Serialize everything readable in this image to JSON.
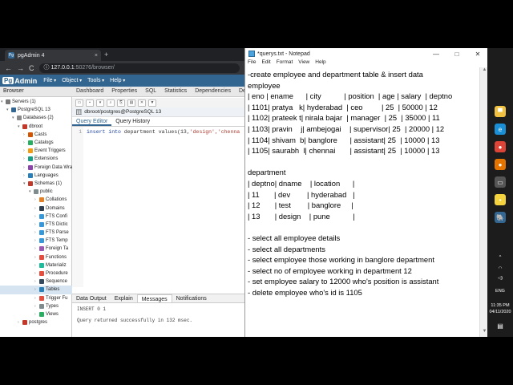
{
  "browser": {
    "tab_title": "pgAdmin 4",
    "tab_close": "×",
    "newtab": "+",
    "nav": {
      "back": "←",
      "forward": "→",
      "reload": "C",
      "info": "ⓘ"
    },
    "url_host": "127.0.0.1",
    "url_path": ":50276/browser/"
  },
  "pgadmin": {
    "logo_pg": "Pg",
    "logo_text": "Admin",
    "menu": [
      "File",
      "Object",
      "Tools",
      "Help"
    ],
    "left_tab": "Browser",
    "tree": [
      {
        "label": "Servers (1)",
        "indent": 0,
        "arrow": "▾",
        "color": "#777"
      },
      {
        "label": "PostgreSQL 13",
        "indent": 1,
        "arrow": "▾",
        "color": "#336791"
      },
      {
        "label": "Databases (2)",
        "indent": 2,
        "arrow": "▾",
        "color": "#8b8b8b"
      },
      {
        "label": "dbroot",
        "indent": 3,
        "arrow": "▾",
        "color": "#c0392b"
      },
      {
        "label": "Casts",
        "indent": 4,
        "arrow": "›",
        "color": "#d35400"
      },
      {
        "label": "Catalogs",
        "indent": 4,
        "arrow": "›",
        "color": "#27ae60"
      },
      {
        "label": "Event Triggers",
        "indent": 4,
        "arrow": "›",
        "color": "#f39c12"
      },
      {
        "label": "Extensions",
        "indent": 4,
        "arrow": "›",
        "color": "#16a085"
      },
      {
        "label": "Foreign Data Wra",
        "indent": 4,
        "arrow": "›",
        "color": "#8e44ad"
      },
      {
        "label": "Languages",
        "indent": 4,
        "arrow": "›",
        "color": "#2980b9"
      },
      {
        "label": "Schemas (1)",
        "indent": 4,
        "arrow": "▾",
        "color": "#c0392b"
      },
      {
        "label": "public",
        "indent": 5,
        "arrow": "▾",
        "color": "#7f8c8d"
      },
      {
        "label": "Collations",
        "indent": 6,
        "arrow": "›",
        "color": "#e67e22"
      },
      {
        "label": "Domains",
        "indent": 6,
        "arrow": "›",
        "color": "#2c3e50"
      },
      {
        "label": "FTS Confi",
        "indent": 6,
        "arrow": "›",
        "color": "#3498db"
      },
      {
        "label": "FTS Dictic",
        "indent": 6,
        "arrow": "›",
        "color": "#3498db"
      },
      {
        "label": "FTS Parse",
        "indent": 6,
        "arrow": "›",
        "color": "#3498db"
      },
      {
        "label": "FTS Temp",
        "indent": 6,
        "arrow": "›",
        "color": "#3498db"
      },
      {
        "label": "Foreign Ta",
        "indent": 6,
        "arrow": "›",
        "color": "#9b59b6"
      },
      {
        "label": "Functions",
        "indent": 6,
        "arrow": "›",
        "color": "#e74c3c"
      },
      {
        "label": "Materializ",
        "indent": 6,
        "arrow": "›",
        "color": "#1abc9c"
      },
      {
        "label": "Procedure",
        "indent": 6,
        "arrow": "›",
        "color": "#e74c3c"
      },
      {
        "label": "Sequence",
        "indent": 6,
        "arrow": "›",
        "color": "#34495e"
      },
      {
        "label": "Tables",
        "indent": 6,
        "arrow": "›",
        "color": "#2980b9",
        "selected": true
      },
      {
        "label": "Trigger Fu",
        "indent": 6,
        "arrow": "›",
        "color": "#e74c3c"
      },
      {
        "label": "Types",
        "indent": 6,
        "arrow": "›",
        "color": "#7f8c8d"
      },
      {
        "label": "Views",
        "indent": 6,
        "arrow": "›",
        "color": "#27ae60"
      },
      {
        "label": "postgres",
        "indent": 3,
        "arrow": "›",
        "color": "#c0392b"
      }
    ],
    "top_tabs": [
      "Dashboard",
      "Properties",
      "SQL",
      "Statistics",
      "Dependencies",
      "Depen"
    ],
    "toolbar_icons": [
      "open",
      "save",
      "save-drop",
      "find",
      "copy",
      "paste",
      "delete",
      "filter"
    ],
    "connection": "dbroot/postgres@PostgreSQL 13",
    "query_tabs": [
      "Query Editor",
      "Query History"
    ],
    "editor_line": "1",
    "editor_code_kw": "insert into",
    "editor_code_rest": " department values(13,",
    "editor_code_str": "'design','chenna",
    "output_tabs": [
      "Data Output",
      "Explain",
      "Messages",
      "Notifications"
    ],
    "output_line1": "INSERT 0 1",
    "output_line2": "Query returned successfully in 132 msec."
  },
  "notepad": {
    "title": "*querys.txt - Notepad",
    "controls": [
      "—",
      "□",
      "✕"
    ],
    "menu": [
      "File",
      "Edit",
      "Format",
      "View",
      "Help"
    ],
    "lines": [
      "-create employee and department table & insert data",
      "employee",
      "| eno | ename      | city           | position  | age | salary  | deptno",
      "| 1101| pratya   k| hyderabad  | ceo         | 25  | 50000 | 12",
      "| 1102| prateek t| nirala bajar  | manager  | 25  | 35000 | 11",
      "| 1103| pravin    j| ambejogai    | supervisor| 25  | 20000 | 12",
      "| 1104| shivam  b| banglore      | assistant| 25  | 10000 | 13",
      "| 1105| saurabh  l| chennai       | assistant| 25  | 10000 | 13",
      "",
      "department",
      "| deptno| dname    | location      |",
      "| 11       | dev        | hyderabad   |",
      "| 12       | test        | banglore     |",
      "| 13       | design    | pune           |",
      "",
      "- select all employee details",
      "- select all departments",
      "- select employee those working in banglore department",
      "- select no of employee working in department 12",
      "- set employee salary to 12000 who's position is assistant",
      "- delete employee who's id is 1105"
    ]
  },
  "taskbar": {
    "icons": [
      {
        "name": "folder-icon",
        "color": "#f0c040",
        "glyph": "▀"
      },
      {
        "name": "edge-icon",
        "color": "#1a8fd6",
        "glyph": "e"
      },
      {
        "name": "chrome-icon",
        "color": "#db4437",
        "glyph": "●"
      },
      {
        "name": "chrome-dev-icon",
        "color": "#e37400",
        "glyph": "●"
      },
      {
        "name": "tablet-icon",
        "color": "#555",
        "glyph": "▭"
      },
      {
        "name": "sticky-icon",
        "color": "#f5d33f",
        "glyph": "▪"
      },
      {
        "name": "pgadmin-icon",
        "color": "#336791",
        "glyph": "🐘"
      }
    ],
    "tray_arrow": "^",
    "lang": "ENG",
    "time": "11:35 PM",
    "date": "04/11/2020",
    "notify": "▤"
  }
}
